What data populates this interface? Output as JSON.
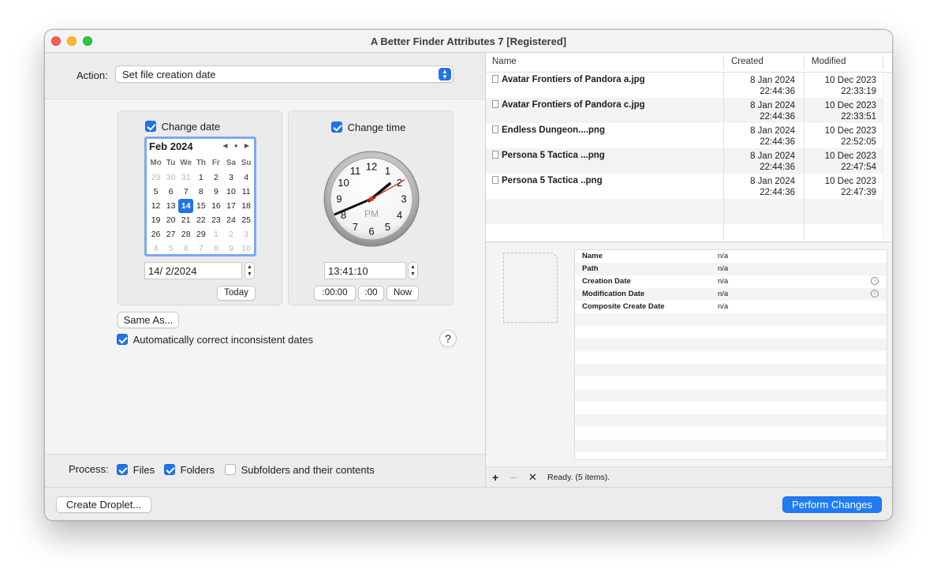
{
  "window": {
    "title": "A Better Finder Attributes 7 [Registered]"
  },
  "action": {
    "label": "Action:",
    "selected": "Set file creation date",
    "arrows": "▲▼"
  },
  "date_panel": {
    "checkbox_label": "Change date",
    "calendar": {
      "month_label": "Feb 2024",
      "nav": "◀ ● ▶",
      "weekdays": [
        "Mo",
        "Tu",
        "We",
        "Th",
        "Fr",
        "Sa",
        "Su"
      ],
      "weeks": [
        [
          "29",
          "30",
          "31",
          "1",
          "2",
          "3",
          "4"
        ],
        [
          "5",
          "6",
          "7",
          "8",
          "9",
          "10",
          "11"
        ],
        [
          "12",
          "13",
          "14",
          "15",
          "16",
          "17",
          "18"
        ],
        [
          "19",
          "20",
          "21",
          "22",
          "23",
          "24",
          "25"
        ],
        [
          "26",
          "27",
          "28",
          "29",
          "1",
          "2",
          "3"
        ],
        [
          "4",
          "5",
          "6",
          "7",
          "8",
          "9",
          "10"
        ]
      ],
      "selected_day": "14"
    },
    "date_value": "14/  2/2024",
    "today_button": "Today"
  },
  "time_panel": {
    "checkbox_label": "Change time",
    "clock": {
      "numbers": [
        "12",
        "1",
        "2",
        "3",
        "4",
        "5",
        "6",
        "7",
        "8",
        "9",
        "10",
        "11"
      ],
      "ampm": "PM",
      "hours": 13,
      "minutes": 41,
      "seconds": 10
    },
    "time_value": "13:41:10",
    "buttons": [
      ":00:00",
      ":00",
      "Now"
    ]
  },
  "same_as_button": "Same As...",
  "auto_correct_label": "Automatically correct inconsistent dates",
  "help_button": "?",
  "process": {
    "label": "Process:",
    "options": [
      {
        "label": "Files",
        "checked": true
      },
      {
        "label": "Folders",
        "checked": true
      },
      {
        "label": "Subfolders and their contents",
        "checked": false
      }
    ]
  },
  "create_droplet_button": "Create Droplet...",
  "perform_changes_button": "Perform Changes",
  "file_table": {
    "columns": [
      "Name",
      "Created",
      "Modified"
    ],
    "rows": [
      {
        "name": "Avatar Frontiers of Pandora a.jpg",
        "created_date": "8 Jan 2024",
        "created_time": "22:44:36",
        "modified_date": "10 Dec 2023",
        "modified_time": "22:33:19"
      },
      {
        "name": "Avatar Frontiers of Pandora c.jpg",
        "created_date": "8 Jan 2024",
        "created_time": "22:44:36",
        "modified_date": "10 Dec 2023",
        "modified_time": "22:33:51"
      },
      {
        "name": "Endless Dungeon....png",
        "created_date": "8 Jan 2024",
        "created_time": "22:44:36",
        "modified_date": "10 Dec 2023",
        "modified_time": "22:52:05"
      },
      {
        "name": "Persona 5 Tactica ...png",
        "created_date": "8 Jan 2024",
        "created_time": "22:44:36",
        "modified_date": "10 Dec 2023",
        "modified_time": "22:47:54"
      },
      {
        "name": "Persona 5 Tactica ..png",
        "created_date": "8 Jan 2024",
        "created_time": "22:44:36",
        "modified_date": "10 Dec 2023",
        "modified_time": "22:47:39"
      }
    ]
  },
  "details": [
    {
      "key": "Name",
      "value": "n/a",
      "arrow": false
    },
    {
      "key": "Path",
      "value": "n/a",
      "arrow": false
    },
    {
      "key": "Creation Date",
      "value": "n/a",
      "arrow": true
    },
    {
      "key": "Modification Date",
      "value": "n/a",
      "arrow": true
    },
    {
      "key": "Composite Create Date",
      "value": "n/a",
      "arrow": false
    }
  ],
  "statusbar": {
    "add": "+",
    "remove": "−",
    "clear": "✕",
    "text": "Ready. (5 items)."
  },
  "colors": {
    "accent": "#1f75e8",
    "second_hand": "#e02b20"
  }
}
